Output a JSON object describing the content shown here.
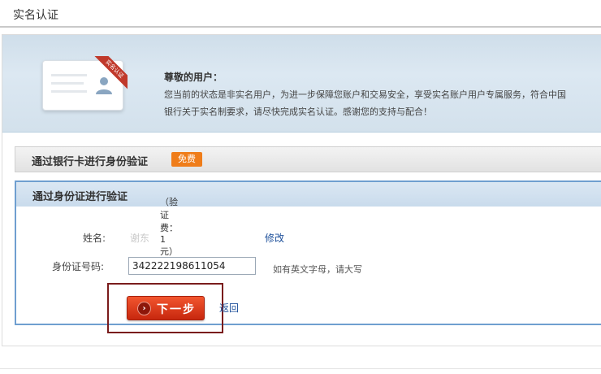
{
  "page": {
    "title": "实名认证"
  },
  "banner": {
    "card_ribbon": "实名认证",
    "greeting": "尊敬的用户：",
    "notice_line1": "您当前的状态是非实名用户，为进一步保障您账户和交易安全，享受实名账户用户专属服务，符合中国",
    "notice_line2": "银行关于实名制要求，请尽快完成实名认证。感谢您的支持与配合！",
    "icons": [
      "id-card-icon",
      "user-avatar-icon"
    ]
  },
  "bank_section": {
    "title": "通过银行卡进行身份验证",
    "badge": "免费"
  },
  "id_section": {
    "title": "通过身份证进行验证",
    "fee_note": "（验证费：1元）",
    "name_label": "姓名:",
    "name_value": "谢东",
    "modify_link": "修改",
    "id_label": "身份证号码:",
    "id_value": "342222198611054",
    "id_hint": "如有英文字母，请大写",
    "next_button": "下一步",
    "back_link": "返回"
  },
  "colors": {
    "banner_bg": "#d6e4ef",
    "badge": "#ef7d1a",
    "button": "#d9381a",
    "section_border": "#6f9fd0",
    "link": "#1d4f9a",
    "highlight_box": "#7a1c1c"
  }
}
